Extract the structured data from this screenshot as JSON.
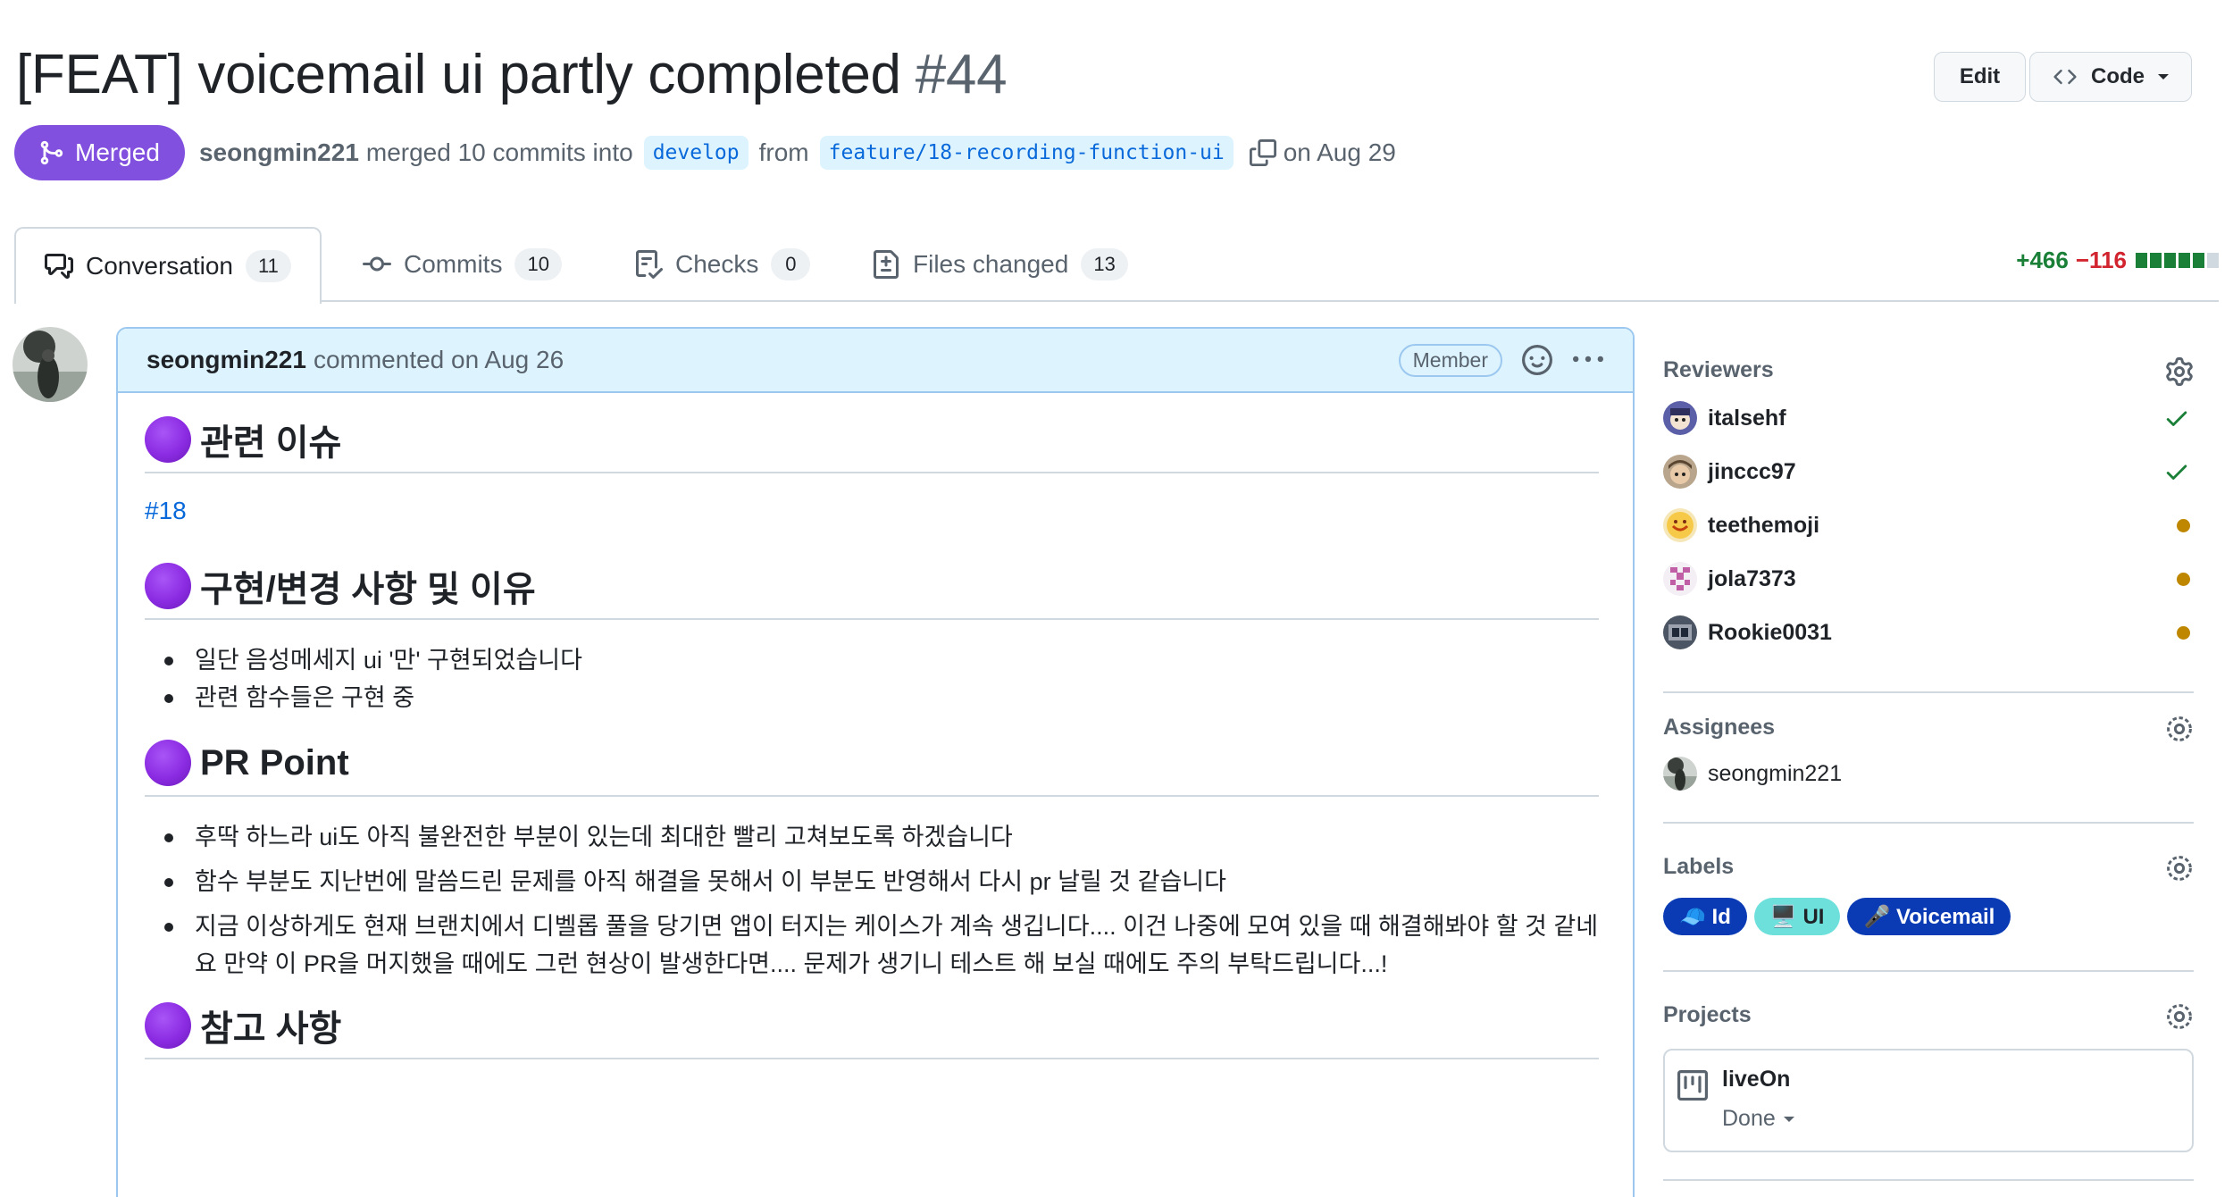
{
  "pr": {
    "title": "[FEAT] voicemail ui partly completed",
    "number": "#44",
    "state": "Merged",
    "author": "seongmin221",
    "merge_text": "merged 10 commits into",
    "base_branch": "develop",
    "from_text": "from",
    "head_branch": "feature/18-recording-function-ui",
    "date_text": "on Aug 29"
  },
  "header_buttons": {
    "edit": "Edit",
    "code": "Code"
  },
  "tabs": [
    {
      "label": "Conversation",
      "count": "11"
    },
    {
      "label": "Commits",
      "count": "10"
    },
    {
      "label": "Checks",
      "count": "0"
    },
    {
      "label": "Files changed",
      "count": "13"
    }
  ],
  "diffstat": {
    "additions": "+466",
    "deletions": "−116",
    "blocks": [
      "#1a7f37",
      "#1a7f37",
      "#1a7f37",
      "#1a7f37",
      "#1a7f37",
      "#d1d9e0"
    ]
  },
  "comment": {
    "author": "seongmin221",
    "meta": "commented on Aug 26",
    "role_badge": "Member",
    "sections": {
      "issue_heading": "관련 이슈",
      "issue_link": "#18",
      "changes_heading": "구현/변경 사항 및 이유",
      "changes": [
        "일단 음성메세지 ui '만' 구현되었습니다",
        "관련 함수들은 구현 중"
      ],
      "point_heading": "PR Point",
      "points": [
        "후딱 하느라 ui도 아직 불완전한 부분이 있는데 최대한 빨리 고쳐보도록 하겠습니다",
        "함수 부분도 지난번에 말씀드린 문제를 아직 해결을 못해서 이 부분도 반영해서 다시 pr 날릴 것 같습니다",
        "지금 이상하게도 현재 브랜치에서 디벨롭 풀을 당기면 앱이 터지는 케이스가 계속 생깁니다.... 이건 나중에 모여 있을 때 해결해봐야 할 것 같네요 만약 이 PR을 머지했을 때에도 그런 현상이 발생한다면.... 문제가 생기니 테스트 해 보실 때에도 주의 부탁드립니다...!"
      ],
      "reference_heading": "참고 사항"
    }
  },
  "sidebar": {
    "reviewers_title": "Reviewers",
    "reviewers": [
      {
        "name": "italsehf",
        "status": "approved"
      },
      {
        "name": "jinccc97",
        "status": "approved"
      },
      {
        "name": "teethemoji",
        "status": "pending"
      },
      {
        "name": "jola7373",
        "status": "pending"
      },
      {
        "name": "Rookie0031",
        "status": "pending"
      }
    ],
    "assignees_title": "Assignees",
    "assignee": "seongmin221",
    "labels_title": "Labels",
    "labels": [
      {
        "text": "🧢 Id",
        "bg": "#0a3bb5",
        "fg": "#ffffff"
      },
      {
        "text": "🖥️ UI",
        "bg": "#6ee0db",
        "fg": "#1f2328"
      },
      {
        "text": "🎤 Voicemail",
        "bg": "#0a3bb5",
        "fg": "#ffffff"
      }
    ],
    "projects_title": "Projects",
    "project": {
      "name": "liveOn",
      "status": "Done"
    }
  }
}
